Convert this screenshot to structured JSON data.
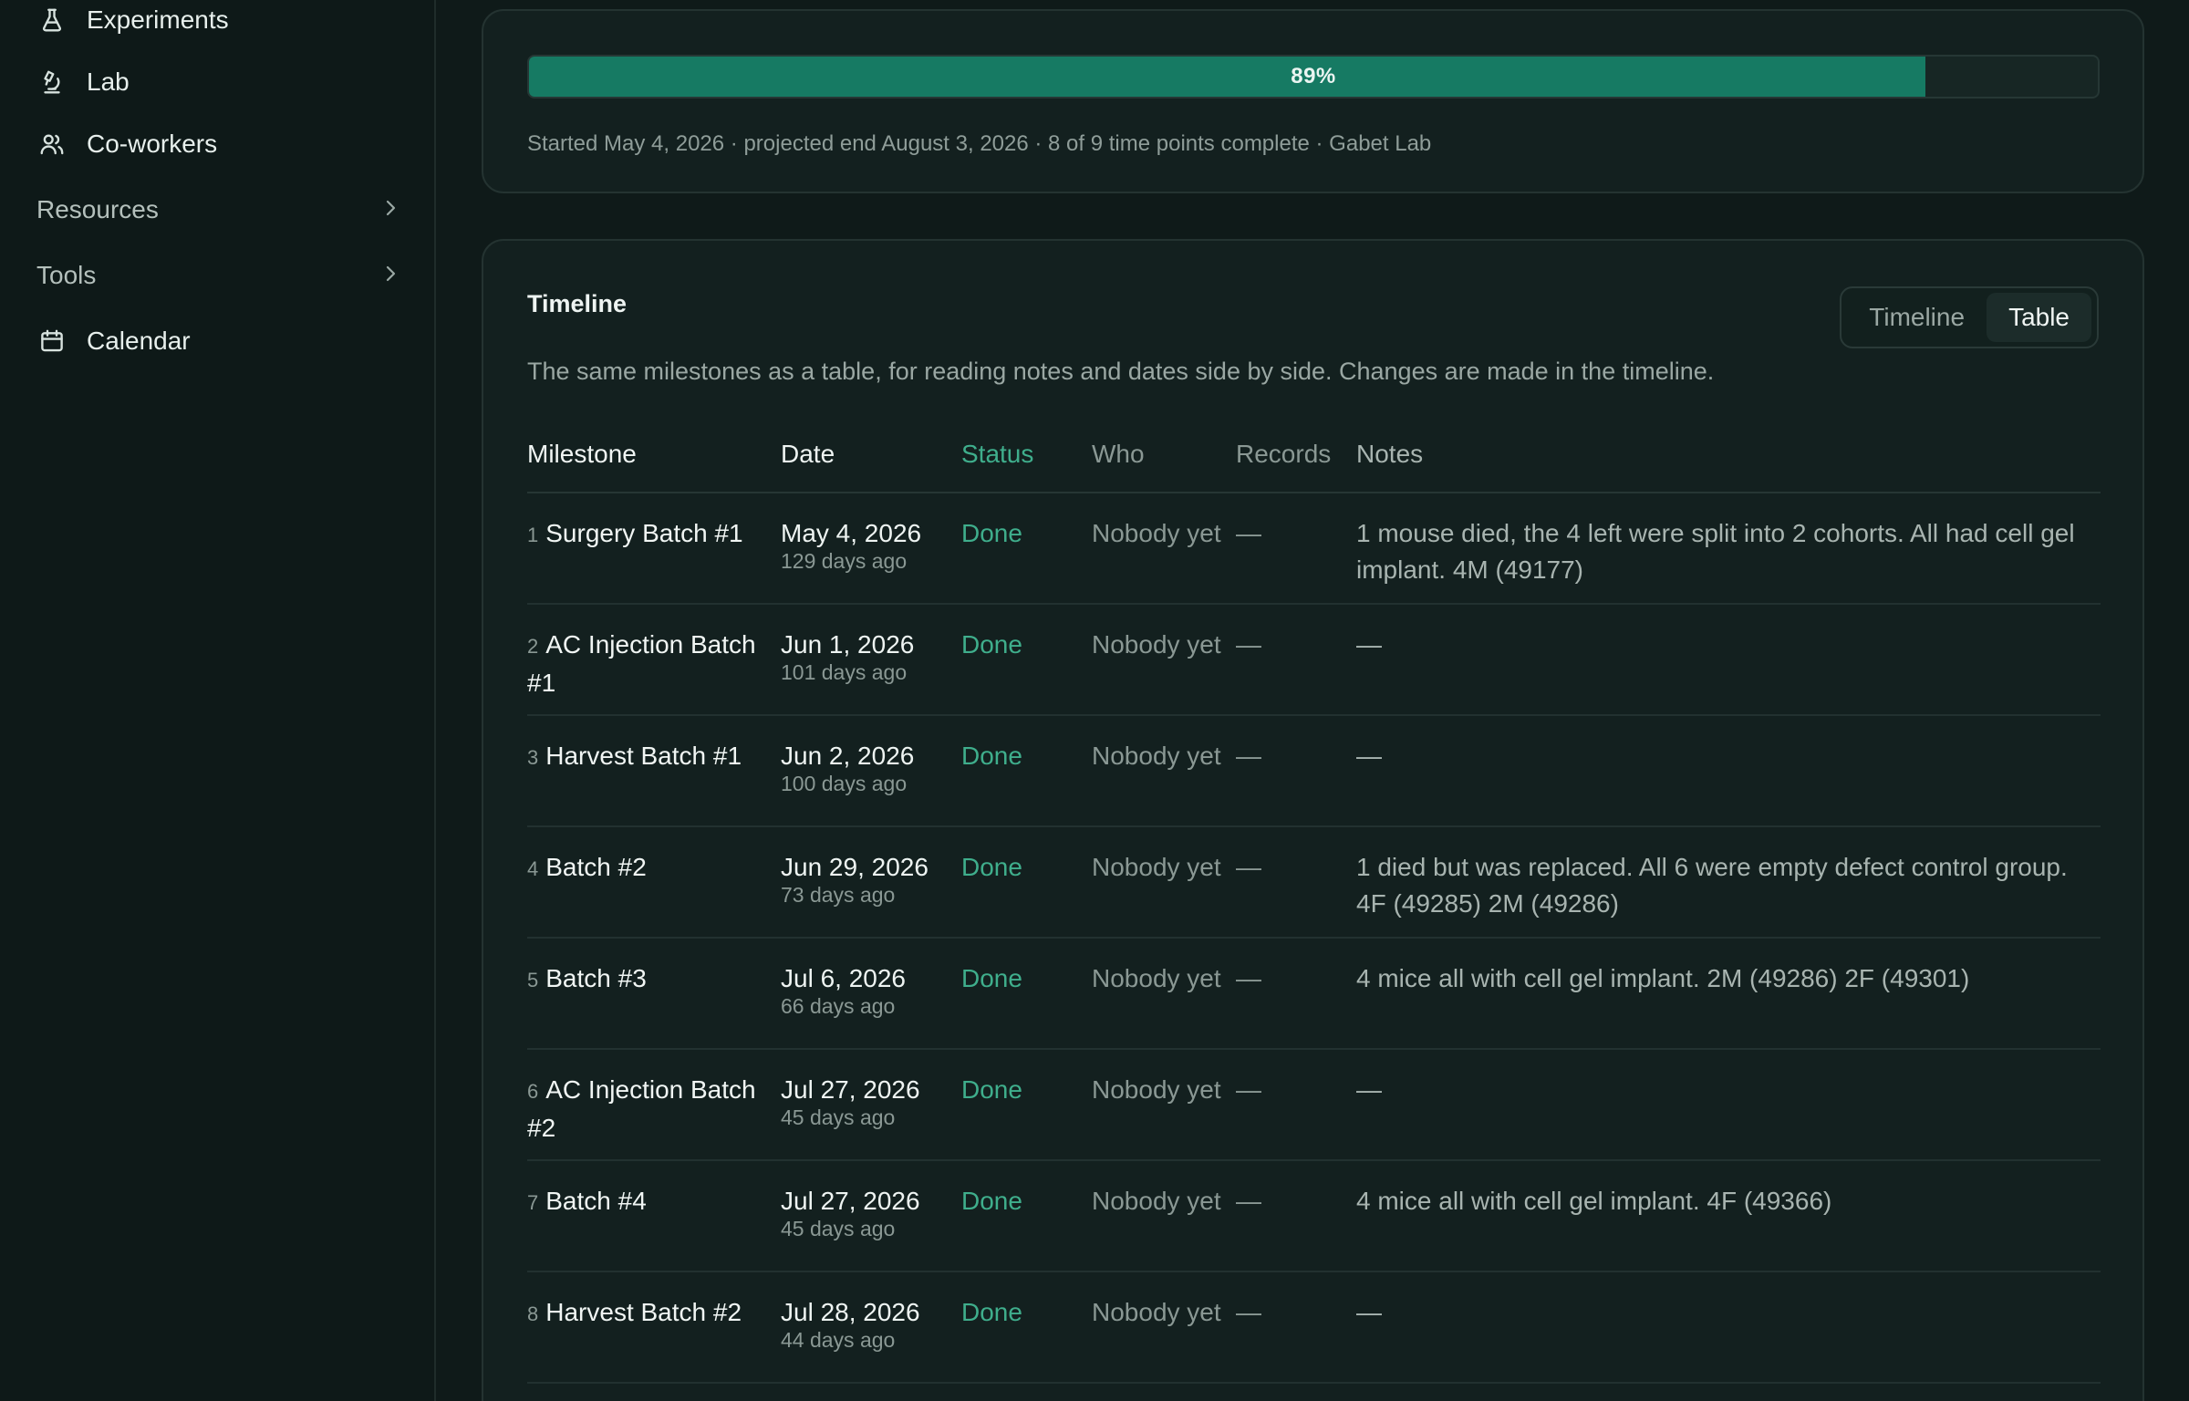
{
  "sidebar": {
    "items": [
      {
        "label": "Experiments",
        "icon": "flask-icon"
      },
      {
        "label": "Lab",
        "icon": "microscope-icon"
      },
      {
        "label": "Co-workers",
        "icon": "users-icon"
      }
    ],
    "groups": [
      {
        "label": "Resources"
      },
      {
        "label": "Tools"
      }
    ],
    "calendar": {
      "label": "Calendar",
      "icon": "calendar-icon"
    }
  },
  "progress": {
    "percent": 89,
    "label": "89%",
    "meta": "Started May 4, 2026 · projected end August 3, 2026 · 8 of 9 time points complete · Gabet Lab"
  },
  "timeline": {
    "title": "Timeline",
    "description": "The same milestones as a table, for reading notes and dates side by side. Changes are made in the timeline.",
    "toggle": {
      "timeline": "Timeline",
      "table": "Table",
      "active": "Table"
    },
    "columns": [
      "Milestone",
      "Date",
      "Status",
      "Who",
      "Records",
      "Notes"
    ],
    "rows": [
      {
        "num": "1",
        "name": "Surgery Batch #1",
        "date": "May 4, 2026",
        "ago": "129 days ago",
        "status": "Done",
        "who": "Nobody yet",
        "records": "—",
        "notes": "1 mouse died, the 4 left were split into 2 cohorts. All had cell gel implant. 4M (49177)"
      },
      {
        "num": "2",
        "name": "AC Injection Batch #1",
        "date": "Jun 1, 2026",
        "ago": "101 days ago",
        "status": "Done",
        "who": "Nobody yet",
        "records": "—",
        "notes": "—"
      },
      {
        "num": "3",
        "name": "Harvest Batch #1",
        "date": "Jun 2, 2026",
        "ago": "100 days ago",
        "status": "Done",
        "who": "Nobody yet",
        "records": "—",
        "notes": "—"
      },
      {
        "num": "4",
        "name": "Batch #2",
        "date": "Jun 29, 2026",
        "ago": "73 days ago",
        "status": "Done",
        "who": "Nobody yet",
        "records": "—",
        "notes": "1 died but was replaced. All 6 were empty defect control group. 4F (49285) 2M (49286)"
      },
      {
        "num": "5",
        "name": "Batch #3",
        "date": "Jul 6, 2026",
        "ago": "66 days ago",
        "status": "Done",
        "who": "Nobody yet",
        "records": "—",
        "notes": "4 mice all with cell gel implant. 2M (49286) 2F (49301)"
      },
      {
        "num": "6",
        "name": "AC Injection Batch #2",
        "date": "Jul 27, 2026",
        "ago": "45 days ago",
        "status": "Done",
        "who": "Nobody yet",
        "records": "—",
        "notes": "—"
      },
      {
        "num": "7",
        "name": "Batch #4",
        "date": "Jul 27, 2026",
        "ago": "45 days ago",
        "status": "Done",
        "who": "Nobody yet",
        "records": "—",
        "notes": "4 mice all with cell gel implant. 4F (49366)"
      },
      {
        "num": "8",
        "name": "Harvest Batch #2",
        "date": "Jul 28, 2026",
        "ago": "44 days ago",
        "status": "Done",
        "who": "Nobody yet",
        "records": "—",
        "notes": "—"
      }
    ]
  },
  "colors": {
    "accent": "#167a63",
    "status_done": "#3fae8c"
  }
}
